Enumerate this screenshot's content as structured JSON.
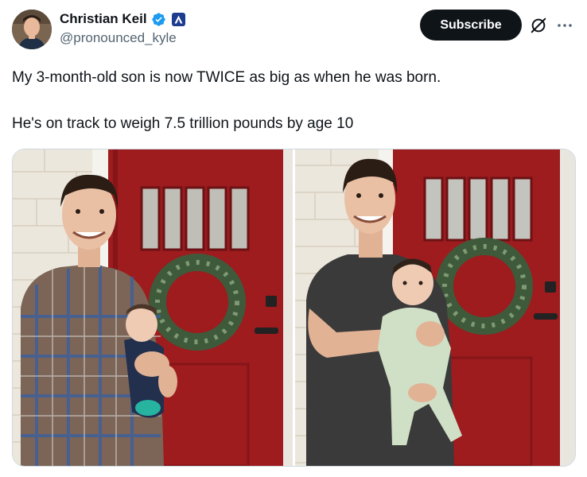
{
  "author": {
    "display_name": "Christian Keil",
    "handle": "@pronounced_kyle"
  },
  "subscribe_label": "Subscribe",
  "post": {
    "line1": "My 3-month-old son is now TWICE as big as when he was born.",
    "line2": "He's on track to weigh 7.5 trillion pounds by age 10"
  },
  "icons": {
    "verified": "verified-badge-icon",
    "affiliation": "affiliation-badge-icon",
    "grok": "grok-icon",
    "more": "more-options-icon"
  },
  "colors": {
    "text_primary": "#0f1419",
    "text_secondary": "#536471",
    "verified_blue": "#1d9bf0",
    "door_red": "#9e1b1e",
    "subscribe_bg": "#0f1419"
  }
}
